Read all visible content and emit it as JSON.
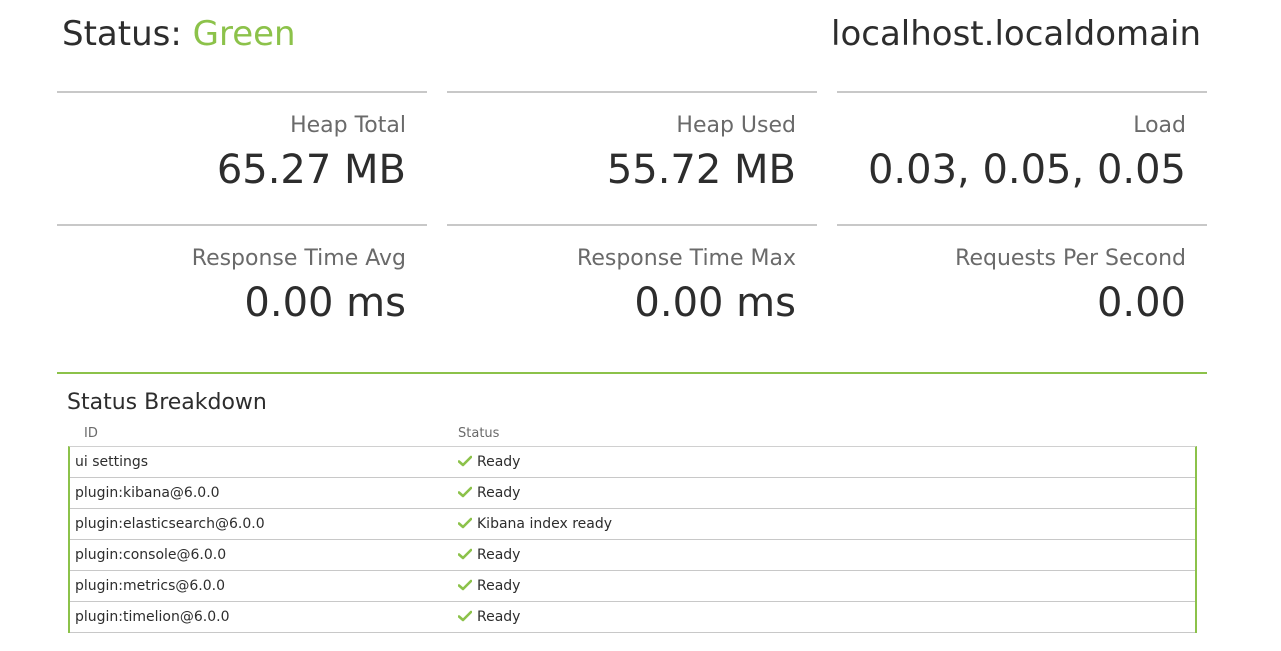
{
  "header": {
    "status_prefix": "Status:",
    "status_value": "Green",
    "host": "localhost.localdomain"
  },
  "metrics": [
    {
      "label": "Heap Total",
      "value": "65.27 MB"
    },
    {
      "label": "Heap Used",
      "value": "55.72 MB"
    },
    {
      "label": "Load",
      "value": "0.03, 0.05, 0.05"
    },
    {
      "label": "Response Time Avg",
      "value": "0.00 ms"
    },
    {
      "label": "Response Time Max",
      "value": "0.00 ms"
    },
    {
      "label": "Requests Per Second",
      "value": "0.00"
    }
  ],
  "breakdown": {
    "title": "Status Breakdown",
    "columns": {
      "id": "ID",
      "status": "Status"
    },
    "rows": [
      {
        "id": "ui settings",
        "status": "Ready",
        "icon": "check-icon"
      },
      {
        "id": "plugin:kibana@6.0.0",
        "status": "Ready",
        "icon": "check-icon"
      },
      {
        "id": "plugin:elasticsearch@6.0.0",
        "status": "Kibana index ready",
        "icon": "check-icon"
      },
      {
        "id": "plugin:console@6.0.0",
        "status": "Ready",
        "icon": "check-icon"
      },
      {
        "id": "plugin:metrics@6.0.0",
        "status": "Ready",
        "icon": "check-icon"
      },
      {
        "id": "plugin:timelion@6.0.0",
        "status": "Ready",
        "icon": "check-icon"
      }
    ]
  },
  "colors": {
    "accent_green": "#8cc24a",
    "text": "#2d2d2d",
    "label_gray": "#6a6a6a",
    "rule_gray": "#c8c8c8"
  }
}
